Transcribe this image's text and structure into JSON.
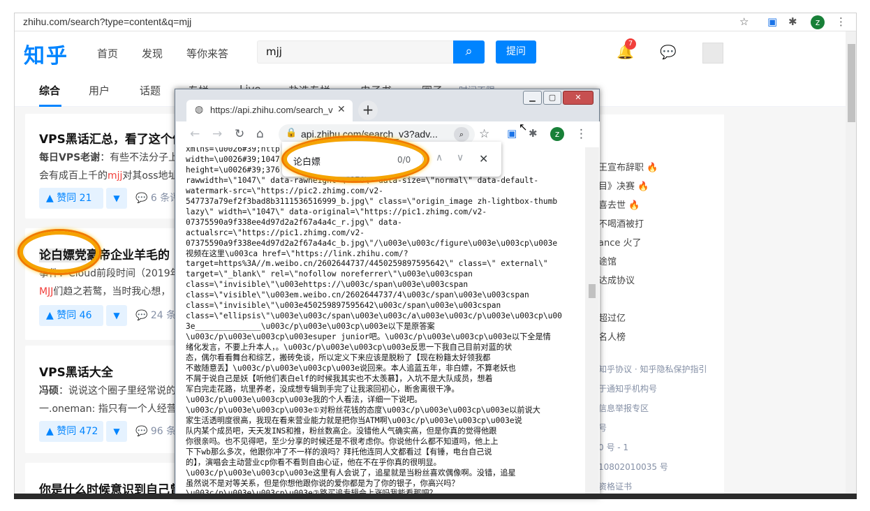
{
  "browser": {
    "url": "zhihu.com/search?type=content&q=mjj",
    "profile_initial": "z"
  },
  "header": {
    "logo": "知乎",
    "nav": [
      "首页",
      "发现",
      "等你来答"
    ],
    "search_value": "mjj",
    "ask_label": "提问",
    "notification_count": "7"
  },
  "tabs": [
    "综合",
    "用户",
    "话题",
    "专栏",
    "Live",
    "盐选专栏",
    "电子书",
    "圈子",
    "时间不限"
  ],
  "results": [
    {
      "title": "VPS黑话汇总，看了这个你就",
      "author": "每日VPS老谢",
      "excerpt_a": "：有些不法分子上",
      "line2_a": "会有成百上千的",
      "line2_hl": "mjj",
      "line2_b": "对其oss地址",
      "votes": "赞同 21",
      "comments": "6 条评"
    },
    {
      "title_a": "论白嫖党",
      "title_b": "豪帝企业羊毛的",
      "author": "",
      "excerpt_a": "事件：Cloud前段时间（2019年",
      "line2_hl": "MJJ",
      "line2_b": "们趋之若鹜，当时我心想，",
      "votes": "赞同 46",
      "comments": "24 条"
    },
    {
      "title": "VPS黑话大全",
      "author": "冯硕",
      "excerpt_a": "：说说这个圈子里经常说的",
      "line2_b": "一.oneman: 指只有一个人经营",
      "votes": "赞同 472",
      "comments": "96 条"
    },
    {
      "title": "你是什么时候意识到自己曾经"
    }
  ],
  "right": {
    "hot": [
      "王宣布辞职",
      "目》决赛",
      "喜去世",
      "不喝酒被打",
      "ance 火了",
      "途馆",
      "达成协议",
      "",
      "超过亿",
      "名人榜"
    ],
    "footer": [
      "知乎协议 · 知乎隐私保护指引",
      "于通知乎机构号",
      "信息举报专区",
      "号",
      "0 号 - 1",
      "10802010035 号",
      "资格证书"
    ]
  },
  "popup": {
    "tab_title": "https://api.zhihu.com/search_v",
    "omnibox": "api.zhihu.com/search_v3?adv...",
    "find_query": "论白嫖",
    "find_count": "0/0",
    "json_text": "xmlns=\\u0026#39;http\nwidth=\\u0026#39;1047\nheight=\\u0026#39;376                               data-\nrawwidth=\\\"1047\\\" data-rawheight=\\\"376\\\" data-size=\\\"normal\\\" data-default-\nwatermark-src=\\\"https://pic2.zhimg.com/v2-\n547737a79ef2f3bad8b3111536516999_b.jpg\\\" class=\\\"origin_image zh-lightbox-thumb\nlazy\\\" width=\\\"1047\\\" data-original=\\\"https://pic1.zhimg.com/v2-\n07375590a9f338ee4d97d2a2f67a4a4c_r.jpg\\\" data-\nactualsrc=\\\"https://pic1.zhimg.com/v2-\n07375590a9f338ee4d97d2a2f67a4a4c_b.jpg\\\"/\\u003e\\u003c/figure\\u003e\\u003cp\\u003e\n视频在这里\\u003ca href=\\\"https://link.zhihu.com/?\ntarget=https%3A//m.weibo.cn/2602644737/4450259897595642\\\" class=\\\" external\\\"\ntarget=\\\"_blank\\\" rel=\\\"nofollow noreferrer\\\"\\u003e\\u003cspan\nclass=\\\"invisible\\\"\\u003ehttps://\\u003c/span\\u003e\\u003cspan\nclass=\\\"visible\\\"\\u003em.weibo.cn/2602644737/4\\u003c/span\\u003e\\u003cspan\nclass=\\\"invisible\\\"\\u003e450259897595642\\u003c/span\\u003e\\u003cspan\nclass=\\\"ellipsis\\\"\\u003e\\u003c/span\\u003e\\u003c/a\\u003e\\u003c/p\\u003e\\u003cp\\u00\n3e______________\\u003c/p\\u003e\\u003cp\\u003e以下是原答案\n\\u003c/p\\u003e\\u003cp\\u003esuper junior吧。\\u003c/p\\u003e\\u003cp\\u003e以下全是情\n绪化发言，不要上升本人，。\\u003c/p\\u003e\\u003cp\\u003e反思一下我自己目前对蓝的状\n态，偶尔看看舞台和综艺，搬砖免谈，所以定义下来应该是脱粉了【现在粉籍太好领我都\n不敢随意丢】\\u003c/p\\u003e\\u003cp\\u003e说回来。本人追蓝五年，非白嫖，不算老妖也\n不屑于说自己是妖【听他们表白elf的时候我其实也不太羡慕】，入坑不是大队成员，想着\n军白完走花路，坑里养老，没成想专辑到手完了让我滚回初心，断舍离很干净。\n\\u003c/p\\u003e\\u003cp\\u003e我的个人看法，详细一下说吧。\n\\u003c/p\\u003e\\u003cp\\u003e①对粉丝花钱的态度\\u003c/p\\u003e\\u003cp\\u003e以前说大\n家生活透明度很高，我现在看来营业能力就是把你当ATM啊\\u003c/p\\u003e\\u003cp\\u003e说\n队内某个成员吧，天天发INS和推，粉丝数高企。没错他人气确实高，但是你真的觉得他跟\n你很亲吗。也不见得吧，至少分享的时候还是不很考虑你。你说他什么都不知道吗，他上上\n下下wb那么多次，他跟你冲了不一样的浪吗？拜托他连同人文都看过【有锤，电台自己说\n的】，演唱会主动营业cp你看不看到自由心证，他在不在乎你真的很明显。\n\\u003c/p\\u003e\\u003cp\\u003e这里有人会说了，追星就是当粉丝喜欢偶像啊。没错，追星\n虽然说不是对等关系，但是你想他跟你说的爱你都是为了你的银子，你高兴吗？\n\\u003c/p\\u003e\\u003cp\\u003e②路买追专辑会上涨吗我能看那吧？"
  }
}
